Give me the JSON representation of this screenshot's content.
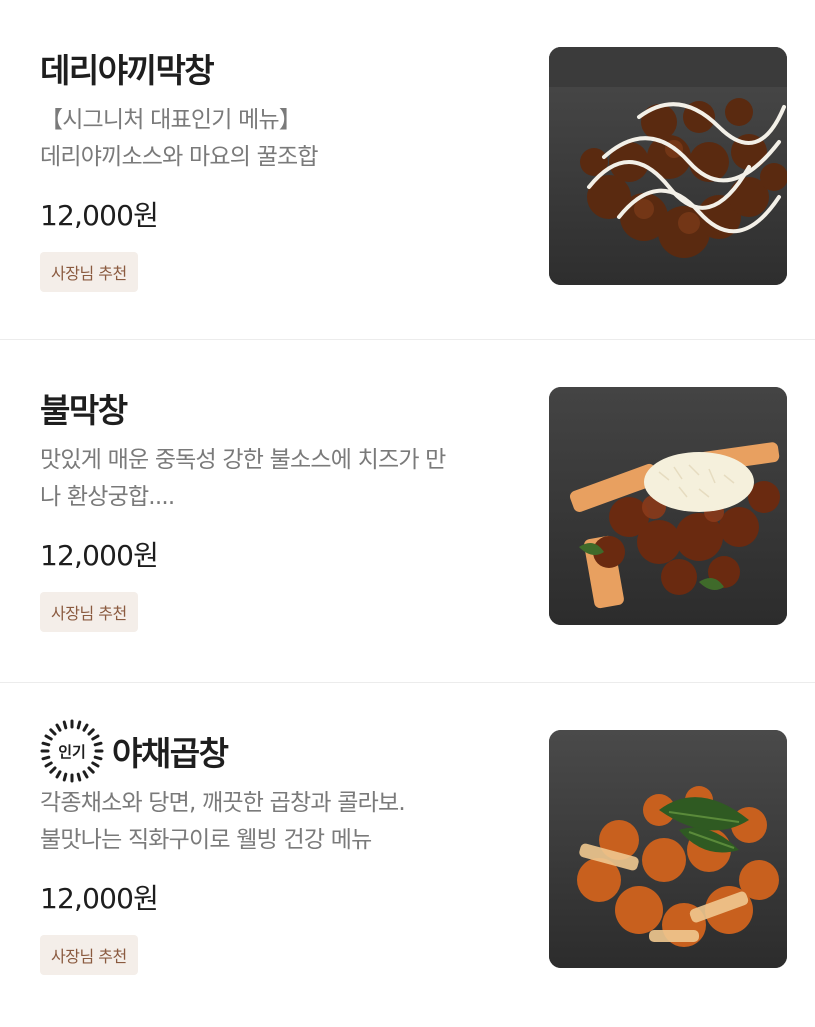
{
  "items": [
    {
      "title": "데리야끼막창",
      "desc_lines": [
        "【시그니처 대표인기 메뉴】",
        "데리야끼소스와 마요의 꿀조합"
      ],
      "price": "12,000원",
      "badge": "사장님 추천",
      "image": "teriyaki-makchang-photo"
    },
    {
      "title": "불막창",
      "desc_lines": [
        "맛있게 매운 중독성 강한 불소스에 치즈가 만",
        "나 환상궁합...."
      ],
      "price": "12,000원",
      "badge": "사장님 추천",
      "image": "spicy-makchang-photo"
    },
    {
      "title": "야채곱창",
      "popular_label": "인기",
      "desc_lines": [
        "각종채소와 당면, 깨끗한 곱창과 콜라보.",
        "불맛나는 직화구이로 웰빙 건강 메뉴"
      ],
      "price": "12,000원",
      "badge": "사장님 추천",
      "image": "vegetable-gopchang-photo"
    }
  ],
  "colors": {
    "badge_bg": "#f4eee9",
    "badge_text": "#8a5a3f",
    "desc_text": "#7a7a7a"
  }
}
